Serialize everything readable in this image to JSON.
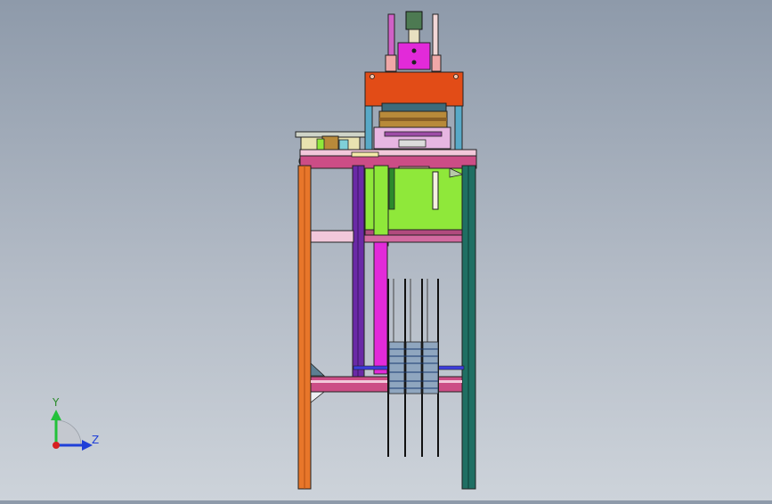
{
  "view": {
    "background_top": "#8e9aaa",
    "background_bottom": "#cdd3da"
  },
  "triad": {
    "y_label": "Y",
    "z_label": "Z",
    "y_color": "#22c13a",
    "z_color": "#1f3fd8",
    "origin_color": "#d62020"
  },
  "colors": {
    "frame_orange": "#e8762a",
    "frame_teal": "#1f6f63",
    "frame_purple": "#6a2aa6",
    "rail_pink": "#cc4d86",
    "head_orange": "#e24c17",
    "cylinder_magenta": "#e22ad9",
    "hopper_green": "#8fe83a",
    "roller_brass": "#b88a3a"
  }
}
